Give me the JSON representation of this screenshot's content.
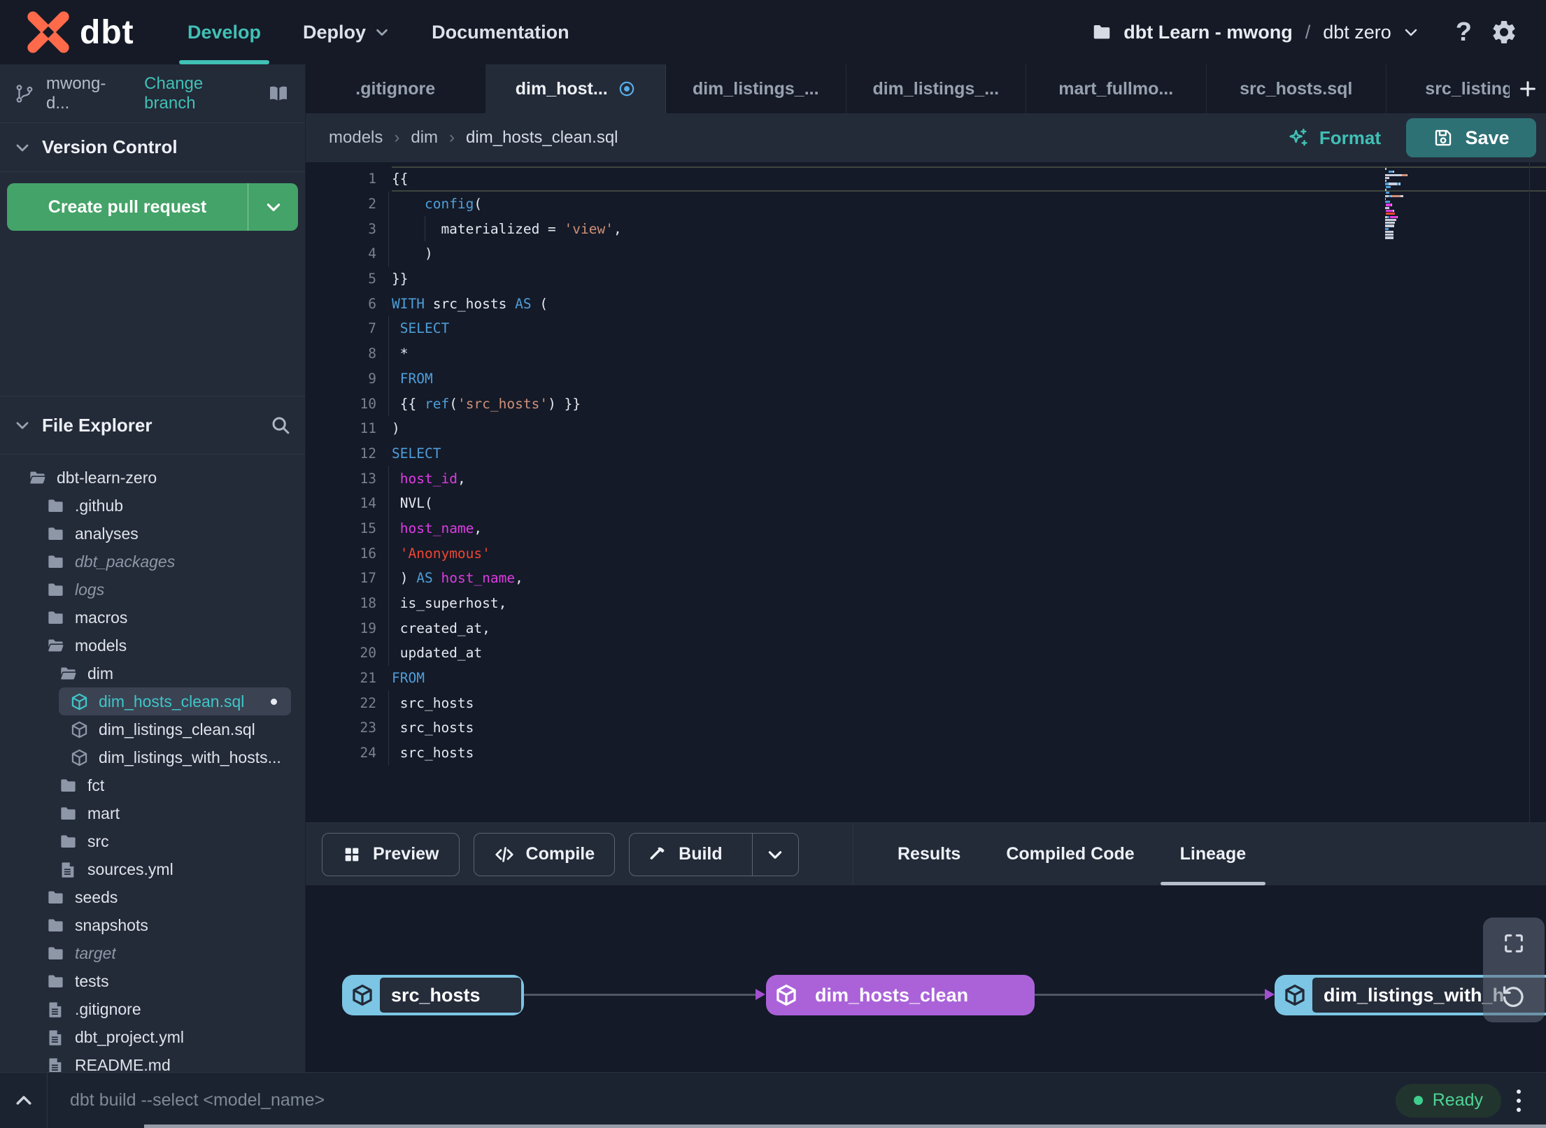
{
  "colors": {
    "accent_teal": "#41c0b5",
    "save_button_teal": "#2d7175",
    "create_pr_green": "#44a368",
    "tab_modified_blue": "#58aee8",
    "lineage_node_blue": "#7cc5e4",
    "lineage_node_purple": "#ab62d8",
    "status_ready_green": "#4fd396",
    "syntax": {
      "keyword": "#4f9ed9",
      "string": "#cf9077",
      "string_literal": "#ee4633",
      "column": "#de3ce3",
      "plain": "#e6e9f0"
    }
  },
  "topnav": {
    "logo_text": "dbt",
    "items": [
      {
        "label": "Develop",
        "active": true,
        "caret": false
      },
      {
        "label": "Deploy",
        "active": false,
        "caret": true
      },
      {
        "label": "Documentation",
        "active": false,
        "caret": false
      }
    ],
    "project_account": "dbt Learn - mwong",
    "project_separator": "/",
    "project_name": "dbt zero"
  },
  "sidebar": {
    "branch_name": "mwong-d...",
    "change_branch_label": "Change branch",
    "version_control_label": "Version Control",
    "create_pull_request_label": "Create pull request",
    "file_explorer_label": "File Explorer",
    "tree": [
      {
        "label": "dbt-learn-zero",
        "type": "folder-open",
        "depth": 0
      },
      {
        "label": ".github",
        "type": "folder",
        "depth": 1
      },
      {
        "label": "analyses",
        "type": "folder",
        "depth": 1
      },
      {
        "label": "dbt_packages",
        "type": "folder",
        "depth": 1,
        "italic": true
      },
      {
        "label": "logs",
        "type": "folder",
        "depth": 1,
        "italic": true
      },
      {
        "label": "macros",
        "type": "folder",
        "depth": 1
      },
      {
        "label": "models",
        "type": "folder-open",
        "depth": 1
      },
      {
        "label": "dim",
        "type": "folder-open",
        "depth": 2
      },
      {
        "label": "dim_hosts_clean.sql",
        "type": "model",
        "depth": 3,
        "selected": true,
        "dot": true
      },
      {
        "label": "dim_listings_clean.sql",
        "type": "model",
        "depth": 3
      },
      {
        "label": "dim_listings_with_hosts...",
        "type": "model",
        "depth": 3
      },
      {
        "label": "fct",
        "type": "folder",
        "depth": 2
      },
      {
        "label": "mart",
        "type": "folder",
        "depth": 2
      },
      {
        "label": "src",
        "type": "folder",
        "depth": 2
      },
      {
        "label": "sources.yml",
        "type": "file",
        "depth": 2
      },
      {
        "label": "seeds",
        "type": "folder",
        "depth": 1
      },
      {
        "label": "snapshots",
        "type": "folder",
        "depth": 1
      },
      {
        "label": "target",
        "type": "folder",
        "depth": 1,
        "italic": true
      },
      {
        "label": "tests",
        "type": "folder",
        "depth": 1
      },
      {
        "label": ".gitignore",
        "type": "file",
        "depth": 1
      },
      {
        "label": "dbt_project.yml",
        "type": "file",
        "depth": 1
      },
      {
        "label": "README.md",
        "type": "file",
        "depth": 1
      }
    ]
  },
  "tabs": [
    {
      "label": ".gitignore",
      "active": false,
      "modified": false
    },
    {
      "label": "dim_host...",
      "active": true,
      "modified": true
    },
    {
      "label": "dim_listings_...",
      "active": false,
      "modified": false
    },
    {
      "label": "dim_listings_...",
      "active": false,
      "modified": false
    },
    {
      "label": "mart_fullmo...",
      "active": false,
      "modified": false
    },
    {
      "label": "src_hosts.sql",
      "active": false,
      "modified": false
    },
    {
      "label": "src_listings.",
      "active": false,
      "modified": false
    }
  ],
  "tab_add_label": "+",
  "breadcrumb": {
    "items": [
      "models",
      "dim",
      "dim_hosts_clean.sql"
    ],
    "separator": "›"
  },
  "editor": {
    "format_label": "Format",
    "save_label": "Save",
    "lines": [
      {
        "n": 1,
        "cur": true,
        "seg": [
          [
            "{{",
            "p"
          ]
        ]
      },
      {
        "n": 2,
        "g": true,
        "seg": [
          [
            "    ",
            "p"
          ],
          [
            "config",
            "k"
          ],
          [
            "(",
            "p"
          ]
        ]
      },
      {
        "n": 3,
        "g": true,
        "g2": true,
        "seg": [
          [
            "      materialized = ",
            "p"
          ],
          [
            "'view'",
            "s"
          ],
          [
            ",",
            "p"
          ]
        ]
      },
      {
        "n": 4,
        "g": true,
        "seg": [
          [
            "    )",
            "p"
          ]
        ]
      },
      {
        "n": 5,
        "seg": [
          [
            "}}",
            "p"
          ]
        ]
      },
      {
        "n": 6,
        "seg": [
          [
            "WITH",
            "k"
          ],
          [
            " src_hosts ",
            "p"
          ],
          [
            "AS",
            "k"
          ],
          [
            " (",
            "p"
          ]
        ]
      },
      {
        "n": 7,
        "g": true,
        "seg": [
          [
            " ",
            "p"
          ],
          [
            "SELECT",
            "k"
          ]
        ]
      },
      {
        "n": 8,
        "g": true,
        "seg": [
          [
            " *",
            "p"
          ]
        ]
      },
      {
        "n": 9,
        "g": true,
        "seg": [
          [
            " ",
            "p"
          ],
          [
            "FROM",
            "k"
          ]
        ]
      },
      {
        "n": 10,
        "g": true,
        "seg": [
          [
            " {{ ",
            "p"
          ],
          [
            "ref",
            "k"
          ],
          [
            "(",
            "p"
          ],
          [
            "'src_hosts'",
            "s"
          ],
          [
            ") }}",
            "p"
          ]
        ]
      },
      {
        "n": 11,
        "seg": [
          [
            ")",
            "p"
          ]
        ]
      },
      {
        "n": 12,
        "seg": [
          [
            "SELECT",
            "k"
          ]
        ]
      },
      {
        "n": 13,
        "g": true,
        "seg": [
          [
            " ",
            "p"
          ],
          [
            "host_id",
            "m"
          ],
          [
            ",",
            "p"
          ]
        ]
      },
      {
        "n": 14,
        "g": true,
        "seg": [
          [
            " NVL(",
            "p"
          ]
        ]
      },
      {
        "n": 15,
        "g": true,
        "seg": [
          [
            " ",
            "p"
          ],
          [
            "host_name",
            "m"
          ],
          [
            ",",
            "p"
          ]
        ]
      },
      {
        "n": 16,
        "g": true,
        "seg": [
          [
            " ",
            "p"
          ],
          [
            "'Anonymous'",
            "r"
          ]
        ]
      },
      {
        "n": 17,
        "g": true,
        "seg": [
          [
            " ) ",
            "p"
          ],
          [
            "AS",
            "k"
          ],
          [
            " ",
            "p"
          ],
          [
            "host_name",
            "m"
          ],
          [
            ",",
            "p"
          ]
        ]
      },
      {
        "n": 18,
        "g": true,
        "seg": [
          [
            " is_superhost,",
            "p"
          ]
        ]
      },
      {
        "n": 19,
        "g": true,
        "seg": [
          [
            " created_at,",
            "p"
          ]
        ]
      },
      {
        "n": 20,
        "g": true,
        "seg": [
          [
            " updated_at",
            "p"
          ]
        ]
      },
      {
        "n": 21,
        "seg": [
          [
            "FROM",
            "k"
          ]
        ]
      },
      {
        "n": 22,
        "g": true,
        "seg": [
          [
            " src_hosts",
            "p"
          ]
        ]
      },
      {
        "n": 23,
        "g": true,
        "seg": [
          [
            " src_hosts",
            "p"
          ]
        ]
      },
      {
        "n": 24,
        "g": true,
        "seg": [
          [
            " src_hosts",
            "p"
          ]
        ]
      }
    ]
  },
  "panel": {
    "preview_label": "Preview",
    "compile_label": "Compile",
    "build_label": "Build",
    "tabs": [
      {
        "label": "Results",
        "active": false
      },
      {
        "label": "Compiled Code",
        "active": false
      },
      {
        "label": "Lineage",
        "active": true
      }
    ]
  },
  "lineage": {
    "nodes": [
      {
        "label": "src_hosts",
        "variant": "source"
      },
      {
        "label": "dim_hosts_clean",
        "variant": "selected"
      },
      {
        "label": "dim_listings_with_h",
        "variant": "source"
      }
    ]
  },
  "cmdbar": {
    "command_placeholder": "dbt build --select <model_name>",
    "status_label": "Ready"
  }
}
